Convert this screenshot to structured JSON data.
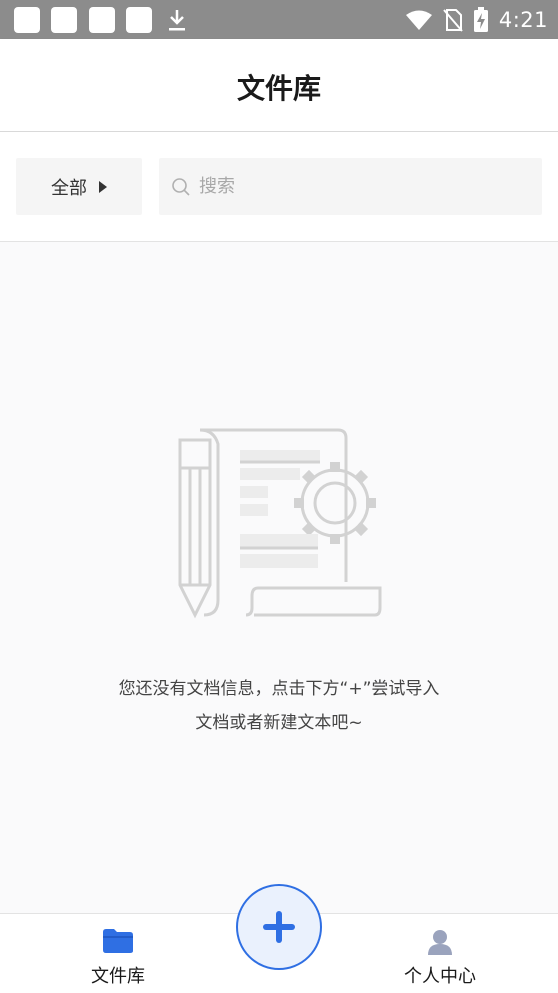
{
  "status_bar": {
    "time": "4:21",
    "icons": [
      "notification-square-icon",
      "notification-square-icon",
      "notification-square-icon",
      "notification-square-icon",
      "download-icon",
      "wifi-icon",
      "no-sim-icon",
      "battery-charging-icon"
    ]
  },
  "header": {
    "title": "文件库"
  },
  "filter": {
    "label": "全部"
  },
  "search": {
    "placeholder": "搜索",
    "value": ""
  },
  "empty_state": {
    "illustration": "document-settings-illustration",
    "line1": "您还没有文档信息，点击下方“+”尝试导入",
    "line2": "文档或者新建文本吧~"
  },
  "tabbar": {
    "tabs": [
      {
        "label": "文件库",
        "icon": "folder-icon",
        "active": true
      },
      {
        "label": "个人中心",
        "icon": "user-icon",
        "active": false
      }
    ],
    "fab_icon": "plus-icon"
  },
  "colors": {
    "accent": "#2f6fe3",
    "status_bar": "#8c8c8c",
    "inactive_icon": "#9aa3bd"
  }
}
